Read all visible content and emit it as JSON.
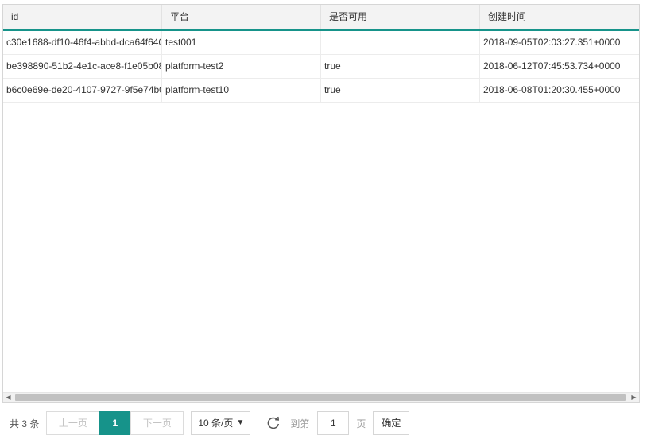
{
  "table": {
    "columns": [
      "id",
      "平台",
      "是否可用",
      "创建时间"
    ],
    "rows": [
      {
        "id": "c30e1688-df10-46f4-abbd-dca64f640",
        "platform": "test001",
        "enabled": "",
        "created": "2018-09-05T02:03:27.351+0000"
      },
      {
        "id": "be398890-51b2-4e1c-ace8-f1e05b08",
        "platform": "platform-test2",
        "enabled": "true",
        "created": "2018-06-12T07:45:53.734+0000"
      },
      {
        "id": "b6c0e69e-de20-4107-9727-9f5e74b0",
        "platform": "platform-test10",
        "enabled": "true",
        "created": "2018-06-08T01:20:30.455+0000"
      }
    ]
  },
  "scrollbar": {
    "left_icon": "left-arrow-icon",
    "right_icon": "right-arrow-icon"
  },
  "pager": {
    "total": "共 3 条",
    "prev": "上一页",
    "current": "1",
    "next": "下一页",
    "page_size": "10 条/页",
    "refresh_icon": "refresh-icon",
    "goto_label": "到第",
    "goto_value": "1",
    "page_suffix": "页",
    "confirm": "确定"
  },
  "colors": {
    "accent": "#16938a",
    "header_bg": "#f3f3f3"
  }
}
